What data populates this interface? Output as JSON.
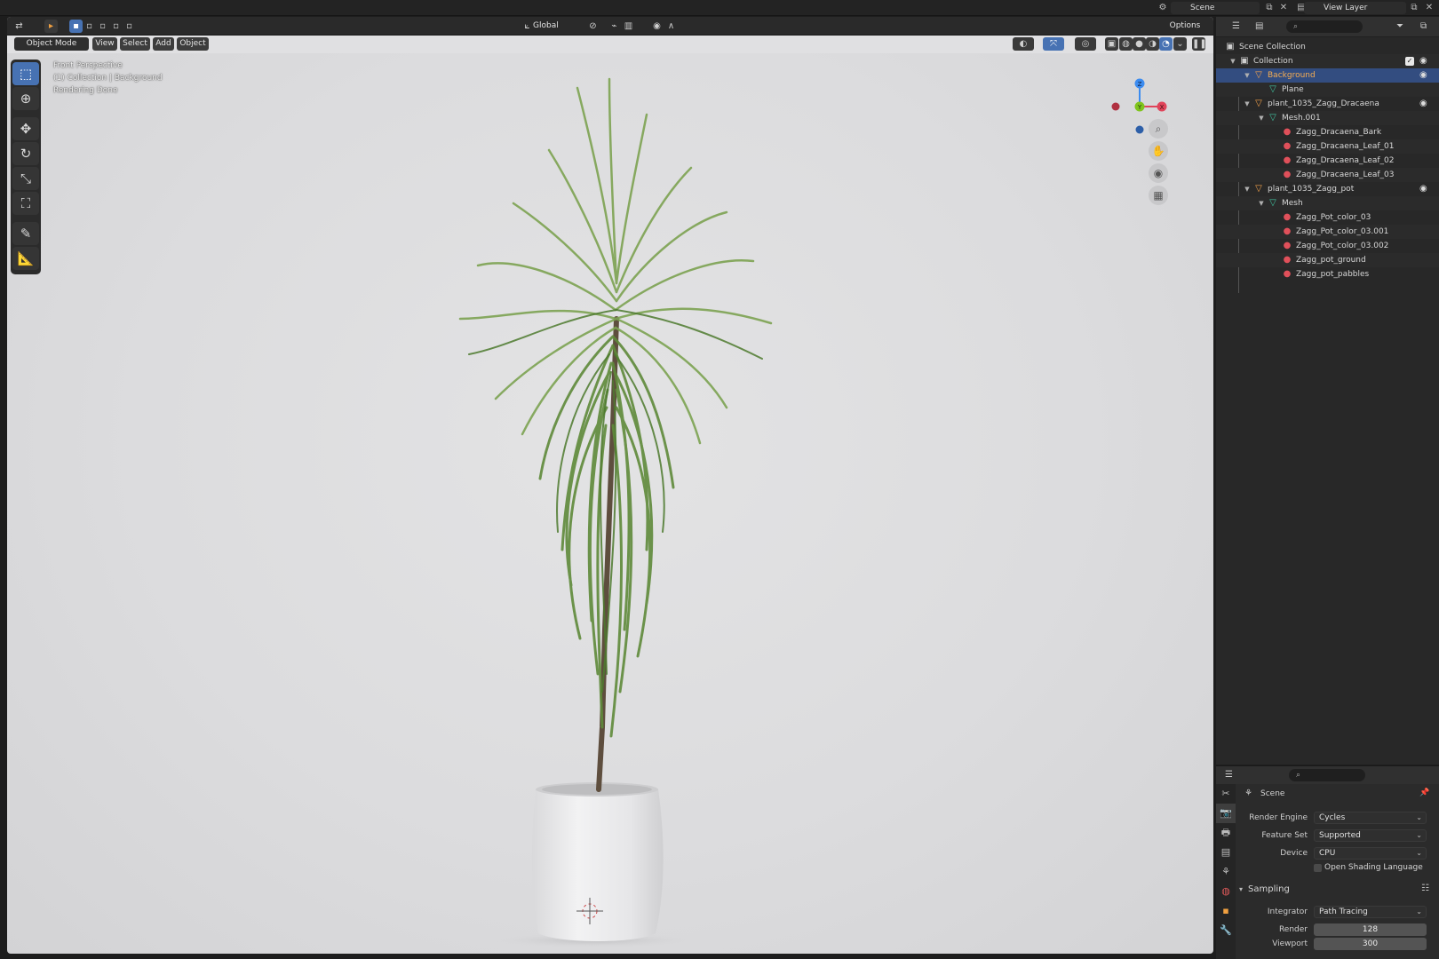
{
  "topbar": {
    "scene": "Scene",
    "view_layer": "View Layer"
  },
  "viewport": {
    "mode": "Object Mode",
    "menu": [
      "View",
      "Select",
      "Add",
      "Object"
    ],
    "transform_orientation": "Global",
    "options": "Options",
    "overlay_lines": [
      "Front Perspective",
      "(1) Collection | Background",
      "Rendering Done"
    ],
    "gizmo_axes": {
      "x": "X",
      "y": "Y",
      "z": "Z"
    }
  },
  "outliner": {
    "rows": [
      {
        "label": "Scene Collection",
        "icon": "scene-collection-icon",
        "depth": 0
      },
      {
        "label": "Collection",
        "icon": "collection-icon",
        "depth": 1
      },
      {
        "label": "Background",
        "icon": "object-icon",
        "depth": 2
      },
      {
        "label": "Plane",
        "icon": "mesh-icon",
        "depth": 3
      },
      {
        "label": "plant_1035_Zagg_Dracaena",
        "icon": "object-icon",
        "depth": 2
      },
      {
        "label": "Mesh.001",
        "icon": "mesh-icon",
        "depth": 3
      },
      {
        "label": "Zagg_Dracaena_Bark",
        "icon": "material-icon",
        "depth": 4
      },
      {
        "label": "Zagg_Dracaena_Leaf_01",
        "icon": "material-icon",
        "depth": 4
      },
      {
        "label": "Zagg_Dracaena_Leaf_02",
        "icon": "material-icon",
        "depth": 4
      },
      {
        "label": "Zagg_Dracaena_Leaf_03",
        "icon": "material-icon",
        "depth": 4
      },
      {
        "label": "plant_1035_Zagg_pot",
        "icon": "object-icon",
        "depth": 2
      },
      {
        "label": "Mesh",
        "icon": "mesh-icon",
        "depth": 3
      },
      {
        "label": "Zagg_Pot_color_03",
        "icon": "material-icon",
        "depth": 4
      },
      {
        "label": "Zagg_Pot_color_03.001",
        "icon": "material-icon",
        "depth": 4
      },
      {
        "label": "Zagg_Pot_color_03.002",
        "icon": "material-icon",
        "depth": 4
      },
      {
        "label": "Zagg_pot_ground",
        "icon": "material-icon",
        "depth": 4
      },
      {
        "label": "Zagg_pot_pabbles",
        "icon": "material-icon",
        "depth": 4
      }
    ]
  },
  "properties": {
    "context": "Scene",
    "render_engine_label": "Render Engine",
    "render_engine": "Cycles",
    "feature_set_label": "Feature Set",
    "feature_set": "Supported",
    "device_label": "Device",
    "device": "CPU",
    "osl_label": "Open Shading Language",
    "sampling_label": "Sampling",
    "integrator_label": "Integrator",
    "integrator": "Path Tracing",
    "render_label": "Render",
    "render_samples": "128",
    "viewport_label": "Viewport",
    "viewport_samples": "300"
  },
  "colors": {
    "selection": "#4772b3",
    "selected_row": "#334d80",
    "object_orange": "#f5a34b",
    "mesh_green": "#40c4a0",
    "material_red": "#e0505a",
    "axis_x": "#e0445a",
    "axis_y": "#7fc41c",
    "axis_z": "#3c8cf0"
  }
}
